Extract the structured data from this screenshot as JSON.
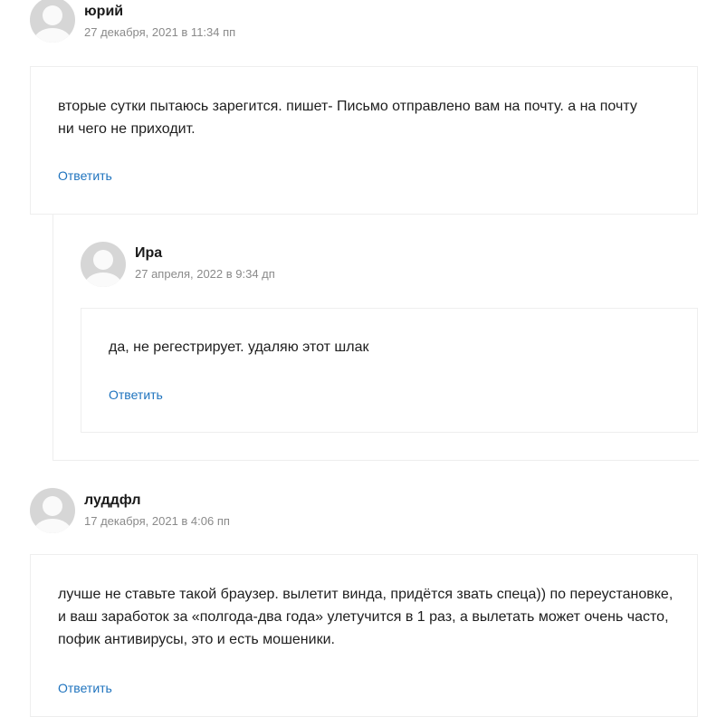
{
  "comments": [
    {
      "author": "юрий",
      "date": "27 декабря, 2021 в 11:34 пп",
      "text": "вторые сутки пытаюсь зарегится. пишет- Письмо отправлено вам на почту. а на почту ни чего не приходит.",
      "reply_label": "Ответить"
    },
    {
      "author": "Ира",
      "date": "27 апреля, 2022 в 9:34 дп",
      "text": "да, не регестрирует. удаляю этот шлак",
      "reply_label": "Ответить"
    },
    {
      "author": "луддфл",
      "date": "17 декабря, 2021 в 4:06 пп",
      "text": "лучше не ставьте такой браузер. вылетит винда, придётся звать спеца)) по переустановке, и ваш заработок за «полгода-два года» улетучится в 1 раз, а вылетать может очень часто, пофик антивирусы, это и есть мошеники.",
      "reply_label": "Ответить"
    }
  ]
}
